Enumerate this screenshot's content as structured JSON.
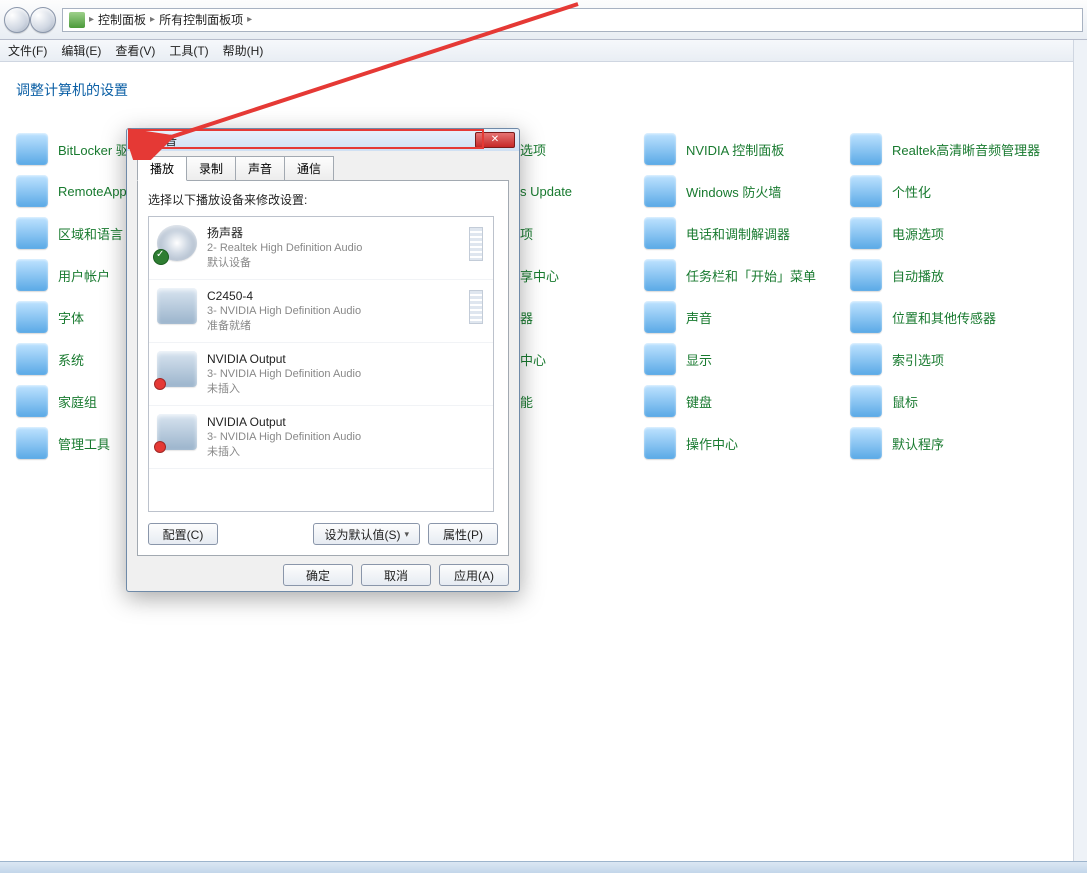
{
  "breadcrumb": {
    "part1": "控制面板",
    "part2": "所有控制面板项",
    "arrow": "▸"
  },
  "menubar": {
    "file": "文件(F)",
    "edit": "编辑(E)",
    "view": "查看(V)",
    "tools": "工具(T)",
    "help": "帮助(H)"
  },
  "heading": "调整计算机的设置",
  "items": {
    "c0": [
      "BitLocker 驱",
      "RemoteApp",
      "区域和语言",
      "用户帐户",
      "字体",
      "系统",
      "家庭组",
      "管理工具"
    ],
    "c1": [
      "选项",
      "s Update",
      "项",
      "享中心",
      "器",
      "中心",
      "能"
    ],
    "c2": [
      "NVIDIA 控制面板",
      "Windows 防火墙",
      "电话和调制解调器",
      "任务栏和「开始」菜单",
      "声音",
      "显示",
      "键盘",
      "操作中心"
    ],
    "c3": [
      "Realtek高清晰音频管理器",
      "个性化",
      "电源选项",
      "自动播放",
      "位置和其他传感器",
      "索引选项",
      "鼠标",
      "默认程序"
    ]
  },
  "dialog": {
    "title": "声音",
    "tabs": {
      "play": "播放",
      "record": "录制",
      "sound": "声音",
      "comm": "通信"
    },
    "instruct": "选择以下播放设备来修改设置:",
    "devices": [
      {
        "name": "扬声器",
        "sub": "2- Realtek High Definition Audio",
        "status": "默认设备",
        "kind": "speaker",
        "badge": "check"
      },
      {
        "name": "C2450-4",
        "sub": "3- NVIDIA High Definition Audio",
        "status": "准备就绪",
        "kind": "monitor",
        "badge": "none"
      },
      {
        "name": "NVIDIA Output",
        "sub": "3- NVIDIA High Definition Audio",
        "status": "未插入",
        "kind": "monitor",
        "badge": "red"
      },
      {
        "name": "NVIDIA Output",
        "sub": "3- NVIDIA High Definition Audio",
        "status": "未插入",
        "kind": "monitor",
        "badge": "red"
      }
    ],
    "btn_config": "配置(C)",
    "btn_default": "设为默认值(S)",
    "btn_props": "属性(P)",
    "btn_ok": "确定",
    "btn_cancel": "取消",
    "btn_apply": "应用(A)"
  }
}
